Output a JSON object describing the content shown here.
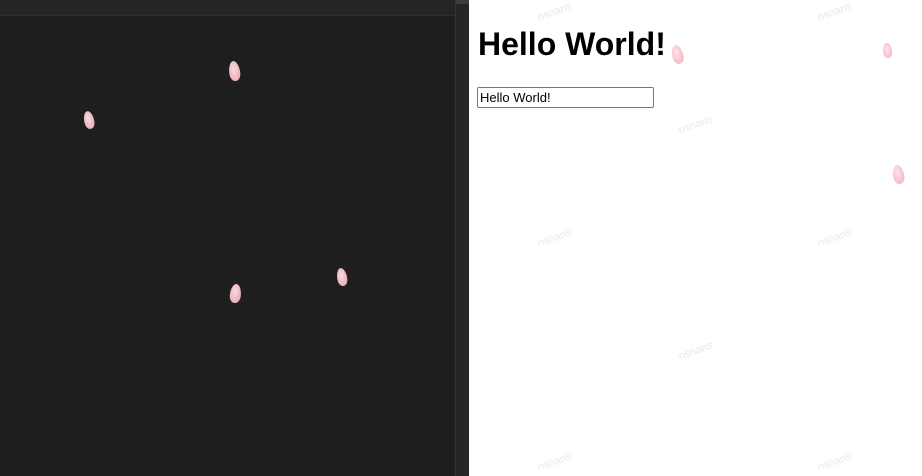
{
  "preview": {
    "heading": "Hello World!",
    "input_value": "Hello World!"
  },
  "watermark": {
    "text": "nsnans"
  },
  "petals": {
    "icon": "cherry-blossom-petal",
    "color": "#f9c0cc"
  },
  "colors": {
    "editor_background": "#1e1e1e",
    "preview_background": "#ffffff"
  }
}
